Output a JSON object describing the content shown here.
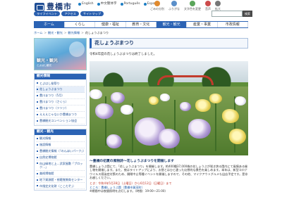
{
  "header": {
    "site_name": "豊橋市",
    "languages": [
      "English",
      "中文簡体字",
      "Português",
      "Español"
    ],
    "utilities": [
      {
        "label": "ごみの分別",
        "icon": "trash-icon"
      },
      {
        "label": "ふりがな",
        "icon": "furigana-icon"
      },
      {
        "label": "文字色を変更",
        "icon": "text-color-icon"
      },
      {
        "label": "音声",
        "icon": "speaker-icon"
      },
      {
        "label": "拡大",
        "icon": "zoom-icon"
      }
    ],
    "sub_links": [
      "ライフイベント",
      "アクセス",
      "サイトマップ"
    ],
    "search_placeholder": "",
    "search_button": "検索"
  },
  "gnav": {
    "items": [
      {
        "label": "ホーム",
        "active": false,
        "home": true
      },
      {
        "label": "くらし",
        "active": false
      },
      {
        "label": "健康・福祉",
        "active": false
      },
      {
        "label": "教育・文化",
        "active": false
      },
      {
        "label": "観光・観光",
        "active": true
      },
      {
        "label": "産業・事業",
        "active": false
      },
      {
        "label": "市政情報",
        "active": false
      }
    ]
  },
  "breadcrumb": [
    "ホーム",
    "観光・観光",
    "観光情報",
    "花しょうぶまつり"
  ],
  "sidebar": {
    "banner_label": "観光・観光",
    "banner_sub": "とよはし観光",
    "section1": {
      "title": "観光情報",
      "items": [
        {
          "label": "とよはし桜祭り",
          "sel": false
        },
        {
          "label": "花しょうぶまつり",
          "sel": true
        },
        {
          "label": "豊川まつり（5月）",
          "sel": false
        },
        {
          "label": "豊川まつり（さくら）",
          "sel": false
        },
        {
          "label": "豊川まつり（ツツジ）",
          "sel": false
        },
        {
          "label": "えええじゃないか豊橋まつり",
          "sel": false
        },
        {
          "label": "豊橋観光コンベンション協会",
          "sel": false
        }
      ]
    },
    "section2": {
      "title": "観光・観光",
      "items": [
        "観光情報",
        "施設情報",
        "豊橋観光情報（『のんほいパーク』）",
        "自然史博物館",
        "向山緑地と上…武家屋敷「ブロック…」",
        "美術博物館",
        "地下資源館・視聴覚教育センター",
        "市指定文化財（ここだぞ」）"
      ]
    }
  },
  "main": {
    "title": "花しょうぶまつり",
    "notice": "令和4年度の花しょうぶまつりは終了しました。",
    "event_head": "～豊橋の初夏の風物詩～花しょうぶまつりを開催します",
    "event_body": "豊橋しょうぶ園にて、「花しょうぶまつり」を開催します。約400種37,000株の花しょうぶが咲き誇る園内にて風情ある催し物を開催します。また、夜はライトアップにより、お昼とはひと違った幻想的な景色を楽しめます。本年は、新型コロナウイルス感染症対策のため、開閉中止等種イベントを開催しますので、その他、マイクアウトグルメも出店予定です。是非お越しください。",
    "event_date": "とき：令和4年5月28日（土曜日）から6月12日（日曜日）まで",
    "event_place": "ところ：豊橋しょうぶ園（豊橋市賀茂町）",
    "event_note": "※期間中は夜間照明を点灯します。（時間：19:00～21:00）"
  }
}
